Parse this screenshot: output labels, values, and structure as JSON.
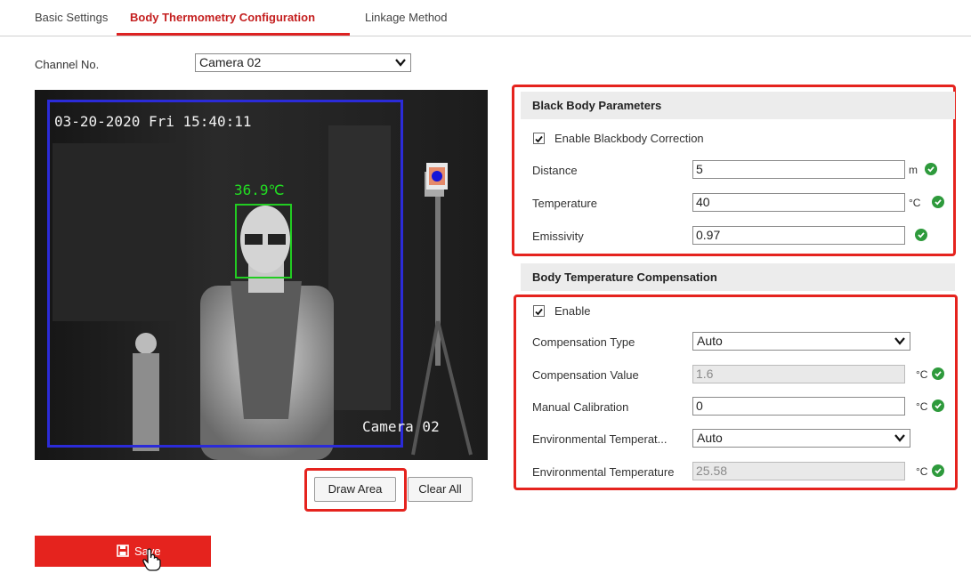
{
  "tabs": [
    {
      "label": "Basic Settings"
    },
    {
      "label": "Body Thermometry Configuration"
    },
    {
      "label": "Linkage Method"
    }
  ],
  "channel": {
    "label": "Channel No.",
    "value": "Camera 02"
  },
  "camera_view": {
    "timestamp": "03-20-2020 Fri 15:40:11",
    "temperature_reading": "36.9℃",
    "channel_name": "Camera 02"
  },
  "blackbody": {
    "title": "Black Body Parameters",
    "enable_label": "Enable Blackbody Correction",
    "enabled": true,
    "distance": {
      "label": "Distance",
      "value": "5",
      "unit": "m"
    },
    "temperature": {
      "label": "Temperature",
      "value": "40",
      "unit": "°C"
    },
    "emissivity": {
      "label": "Emissivity",
      "value": "0.97"
    }
  },
  "compensation": {
    "title": "Body Temperature Compensation",
    "enable_label": "Enable",
    "enabled": true,
    "type": {
      "label": "Compensation Type",
      "value": "Auto"
    },
    "value": {
      "label": "Compensation Value",
      "value": "1.6",
      "unit": "°C"
    },
    "manual": {
      "label": "Manual Calibration",
      "value": "0",
      "unit": "°C"
    },
    "env_mode": {
      "label": "Environmental Temperat...",
      "value": "Auto"
    },
    "env_temp": {
      "label": "Environmental Temperature",
      "value": "25.58",
      "unit": "°C"
    }
  },
  "buttons": {
    "draw_area": "Draw Area",
    "clear_all": "Clear All",
    "save": "Save"
  },
  "colors": {
    "accent": "#e5231e",
    "ok": "#2e9a3c",
    "detection_box": "#2b2bd8",
    "face_box": "#22cc22"
  }
}
